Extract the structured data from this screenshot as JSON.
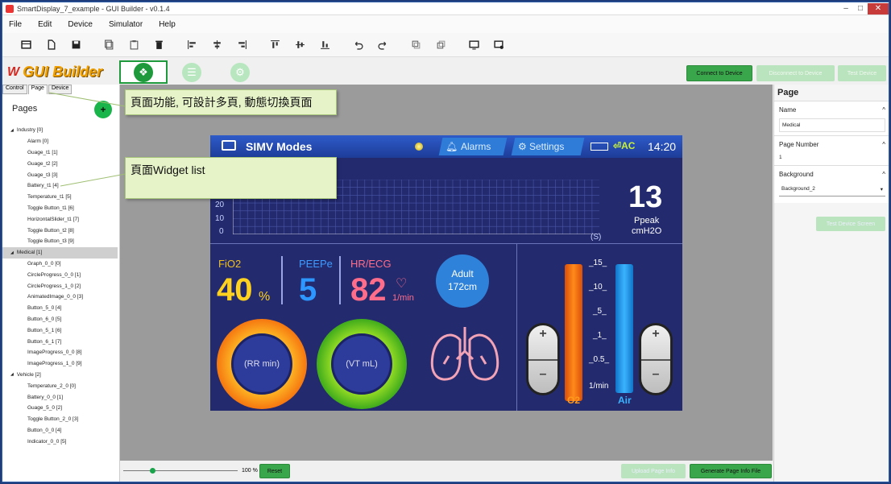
{
  "window": {
    "title": "SmartDisplay_7_example - GUI Builder - v0.1.4",
    "min": "–",
    "max": "□",
    "close": "✕"
  },
  "menu": [
    "File",
    "Edit",
    "Device",
    "Simulator",
    "Help"
  ],
  "toolbar_icons": [
    "new-icon",
    "open-file-icon",
    "save-icon",
    "copy-icon",
    "paste-icon",
    "delete-icon",
    "align-left-icon",
    "align-center-icon",
    "align-right-icon",
    "align-top-icon",
    "align-middle-icon",
    "align-bottom-icon",
    "undo-icon",
    "redo-icon",
    "bring-front-icon",
    "send-back-icon",
    "preview-icon",
    "simulate-icon"
  ],
  "brand": {
    "mark": "W",
    "name": "GUI Builder"
  },
  "top_buttons": {
    "connect": "Connect to Device",
    "disconnect": "Disconnect to Device",
    "test": "Test Device"
  },
  "left": {
    "tabs": [
      "Control",
      "Page",
      "Device"
    ],
    "title": "Pages",
    "add": "+",
    "groups": [
      {
        "name": "Industry [0]",
        "items": [
          "Alarm [0]",
          "Guage_t1 [1]",
          "Guage_t2 [2]",
          "Guage_t3 [3]",
          "Battery_t1 [4]",
          "Temperature_t1 [5]",
          "Toggle Button_t1 [6]",
          "HorizontalSlider_t1 [7]",
          "Toggle Button_t2 [8]",
          "Toggle Button_t3 [9]"
        ]
      },
      {
        "name": "Medical [1]",
        "items": [
          "Graph_0_0 [0]",
          "CircleProgress_0_0 [1]",
          "CircleProgress_1_0 [2]",
          "AnimatedImage_0_0 [3]",
          "Button_5_0 [4]",
          "Button_6_0 [5]",
          "Button_5_1 [6]",
          "Button_6_1 [7]",
          "ImageProgress_0_0 [8]",
          "ImageProgress_1_0 [9]"
        ]
      },
      {
        "name": "Vehicle [2]",
        "items": [
          "Temperature_2_0 [0]",
          "Battery_0_0 [1]",
          "Guage_5_0 [2]",
          "Toggle Button_2_0 [3]",
          "Button_0_0 [4]",
          "Indicator_0_0 [5]"
        ]
      }
    ]
  },
  "callouts": {
    "page_feature": "頁面功能, 可設計多頁, 動態切換頁面",
    "widget_list": "頁面Widget list"
  },
  "device": {
    "title": "SIMV Modes",
    "alarms": "Alarms",
    "settings": "Settings",
    "ac": "AC",
    "time": "14:20",
    "graph_y": [
      "20",
      "10",
      "0"
    ],
    "graph_x_unit": "(S)",
    "peak_value": "13",
    "peak_label": "Ppeak",
    "peak_unit": "cmH2O",
    "fio2_label": "FiO2",
    "fio2_value": "40",
    "fio2_unit": "%",
    "peep_label": "PEEPe",
    "peep_value": "5",
    "hr_label": "HR/ECG",
    "hr_value": "82",
    "hr_unit": "1/min",
    "adult": "Adult",
    "height": "172cm",
    "rr": "(RR min)",
    "vt": "(VT mL)",
    "scale": [
      "_15_",
      "_10_",
      "_5_",
      "_1_",
      "_0.5_",
      "1/min"
    ],
    "o2": "O2",
    "air": "Air",
    "plus": "+",
    "minus": "–"
  },
  "right": {
    "title": "Page",
    "name_label": "Name",
    "name_value": "Medical",
    "number_label": "Page Number",
    "number_value": "1",
    "bg_label": "Background",
    "bg_value": "Background_2",
    "test_screen": "Test Device Screen",
    "collapse": "^"
  },
  "bottom": {
    "zoom": "100 %",
    "reset": "Reset",
    "upload": "Upload Page Info",
    "generate": "Generate Page Info File"
  }
}
